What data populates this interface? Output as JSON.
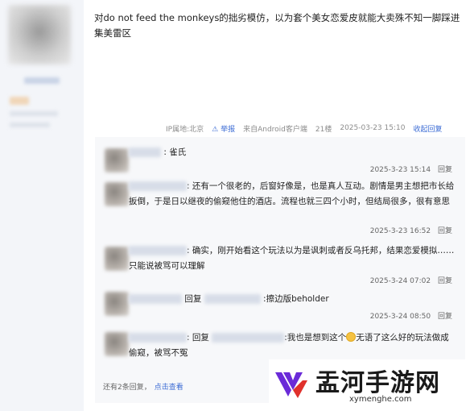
{
  "post": {
    "text": "对do not feed the monkeys的拙劣模仿，以为套个美女恋爱皮就能大卖殊不知一脚踩进集美雷区",
    "footer": {
      "ip": "IP属地:北京",
      "report": "举报",
      "source": "来自Android客户端",
      "floor": "21楼",
      "datetime": "2025-03-23 15:10",
      "collapse_reply": "收起回复"
    }
  },
  "replies": [
    {
      "text": ": 雀氏",
      "datetime": "2025-3-23 15:14",
      "reply_label": "回复"
    },
    {
      "text": ": 还有一个很老的，后窗好像是，也是真人互动。剧情是男主想把市长给扳倒，于是日以继夜的偷窥他住的酒店。流程也就三四个小时，但结局很多，很有意思",
      "datetime": "2025-3-23 16:52",
      "reply_label": "回复"
    },
    {
      "text": ": 确实，刚开始看这个玩法以为是讽刺或者反乌托邦，结果恋爱模拟……只能说被骂可以理解",
      "datetime": "2025-3-24 07:02",
      "reply_label": "回复"
    },
    {
      "prefix": "回复",
      "text": ":擦边版beholder",
      "datetime": "2025-3-24 08:50",
      "reply_label": "回复"
    },
    {
      "prefix": ": 回复",
      "text_a": ":我也是想到这个",
      "text_b": "无语了这么好的玩法做成偷窥，被骂不冤",
      "datetime": "",
      "reply_label": ""
    }
  ],
  "more": {
    "count_text": "还有2条回复，",
    "link": "点击查看"
  },
  "watermark": {
    "title": "盂河手游网",
    "domain": "xymenghe.com",
    "colors": {
      "logo_purple": "#6a2bd8",
      "logo_red": "#e0312c"
    }
  },
  "colors": {
    "link_blue": "#3b6bd4",
    "reply_bg": "#f7f8fa",
    "sidebar_bg": "#f3f5f9"
  }
}
